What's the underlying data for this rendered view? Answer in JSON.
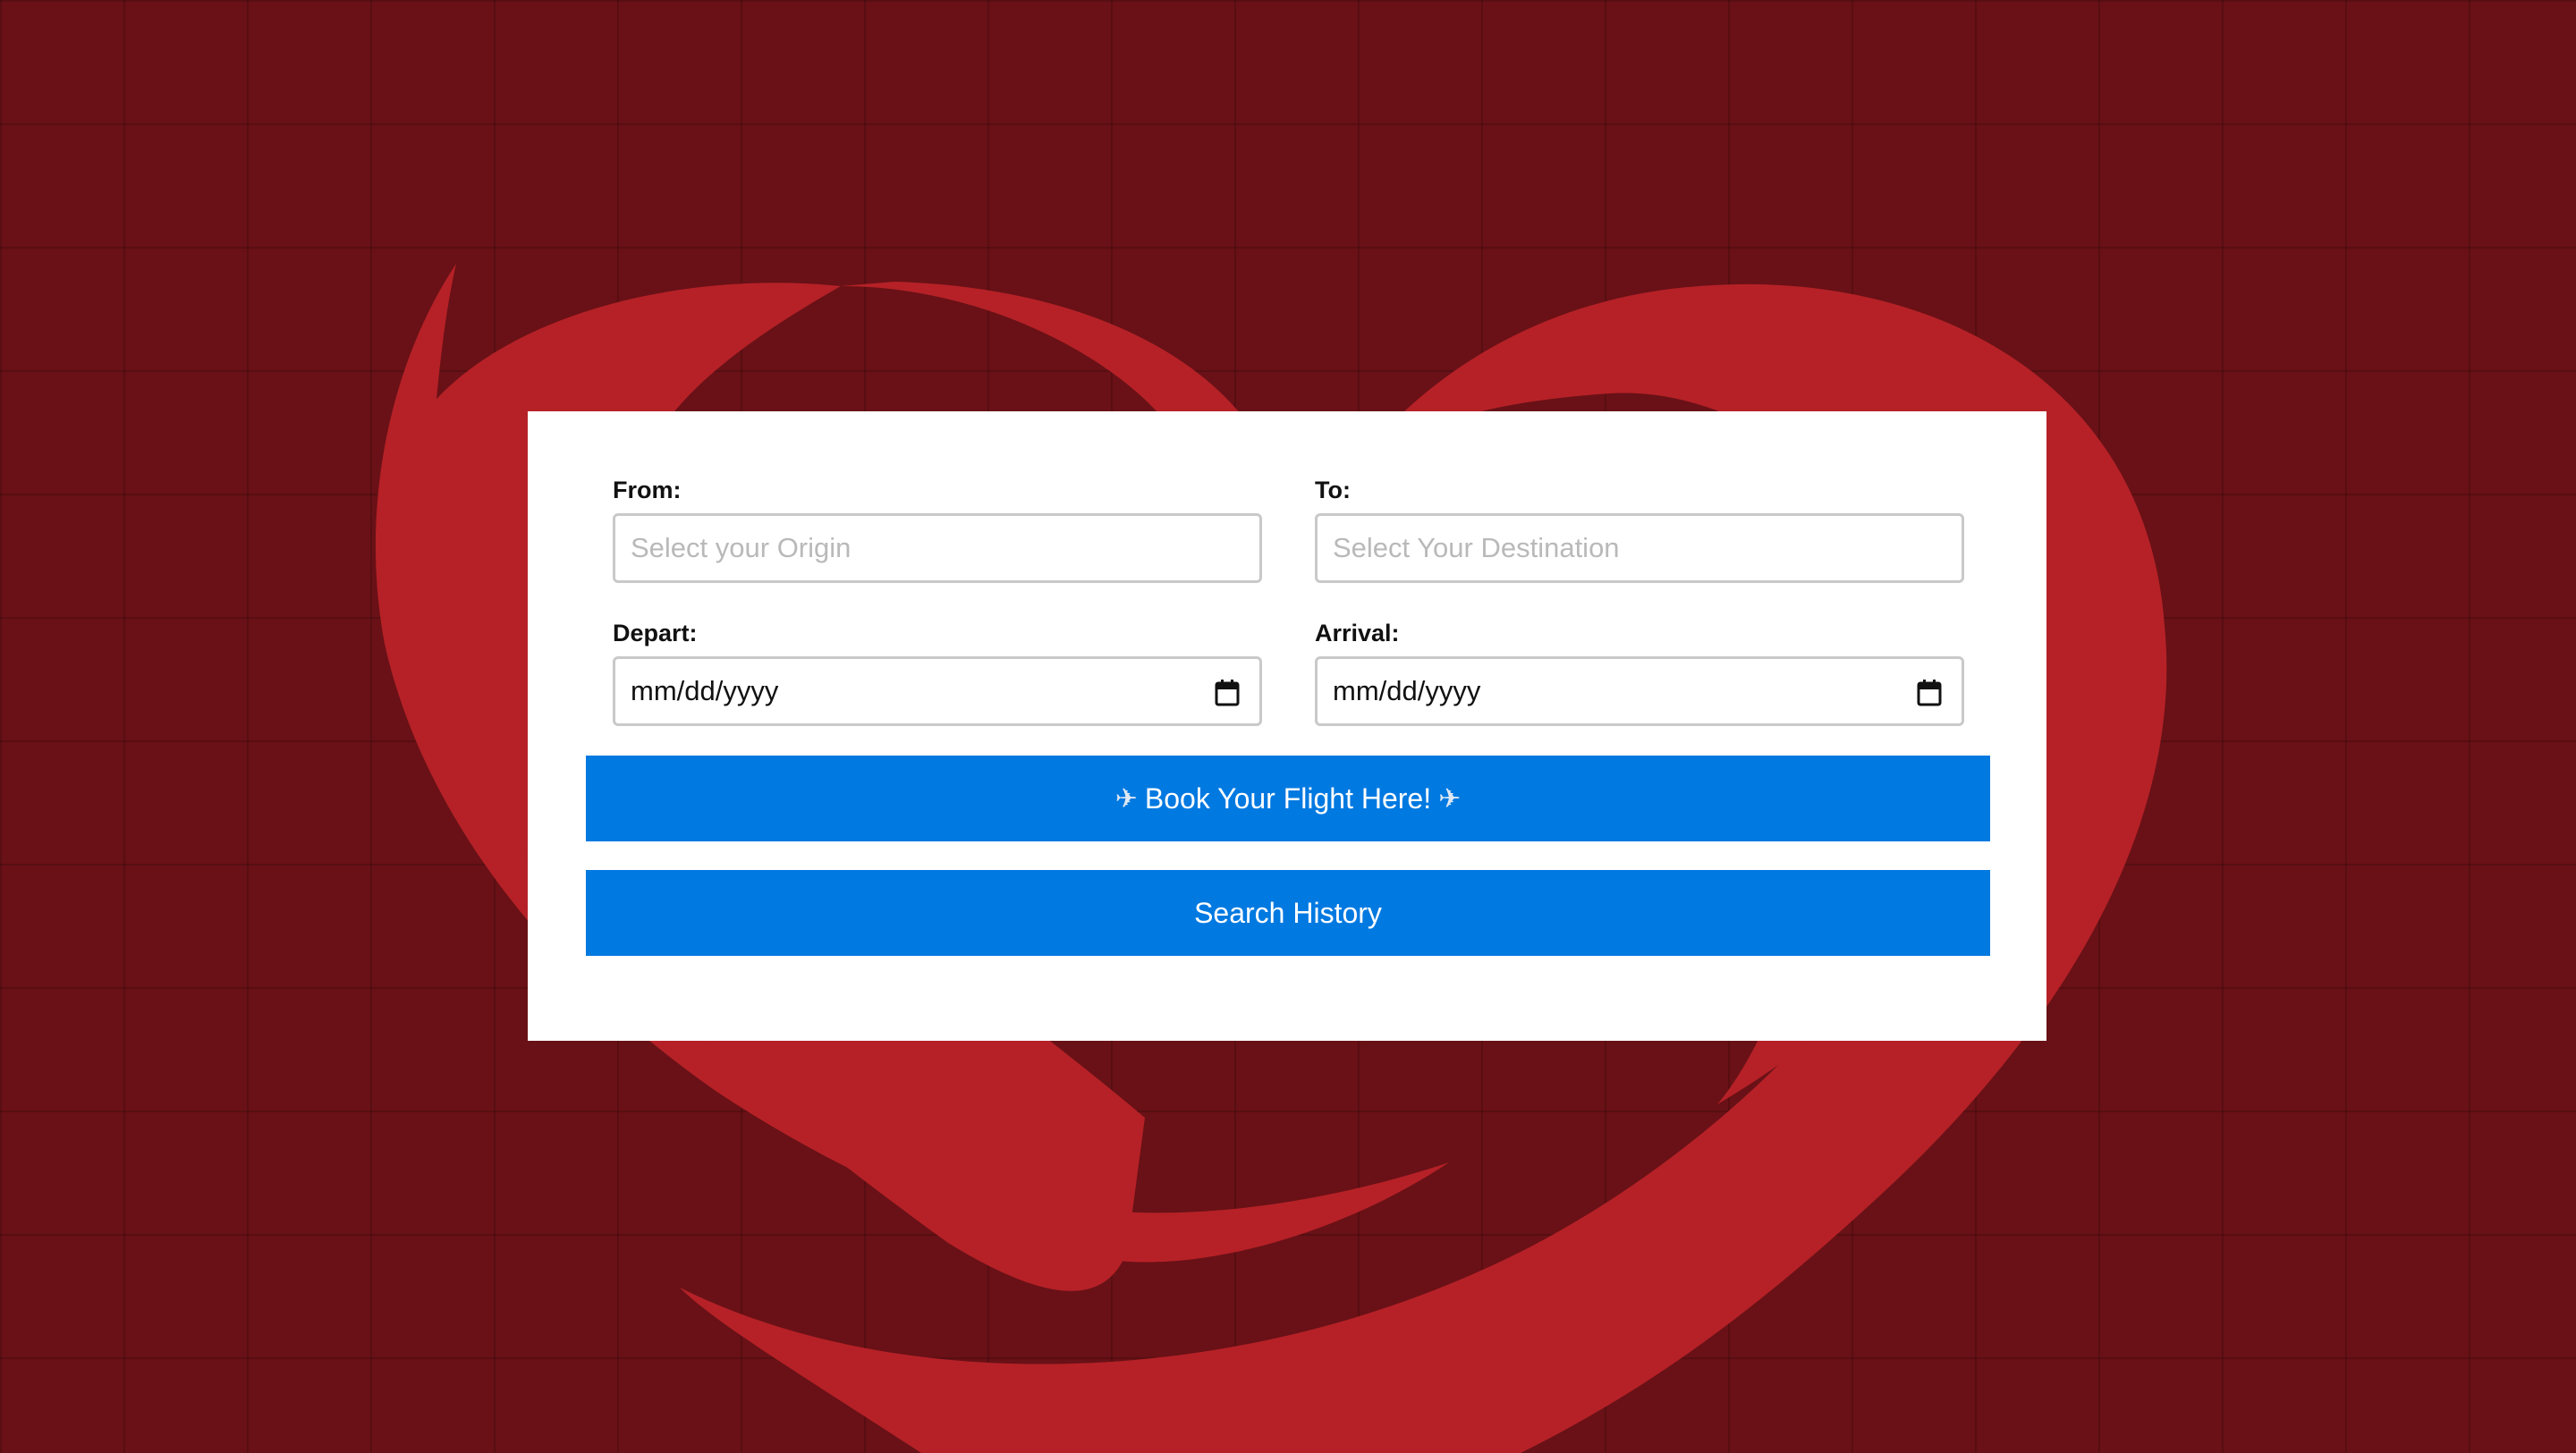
{
  "form": {
    "from": {
      "label": "From:",
      "placeholder": "Select your Origin"
    },
    "to": {
      "label": "To:",
      "placeholder": "Select Your Destination"
    },
    "depart": {
      "label": "Depart:",
      "value": "mm/dd/yyyy"
    },
    "arrival": {
      "label": "Arrival:",
      "value": "mm/dd/yyyy"
    }
  },
  "buttons": {
    "book": {
      "label": "Book Your Flight Here!",
      "icon": "airplane-icon"
    },
    "history": {
      "label": "Search History"
    }
  },
  "colors": {
    "background": "#691116",
    "logo": "#b52127",
    "button": "#0079e1",
    "card": "#ffffff"
  }
}
